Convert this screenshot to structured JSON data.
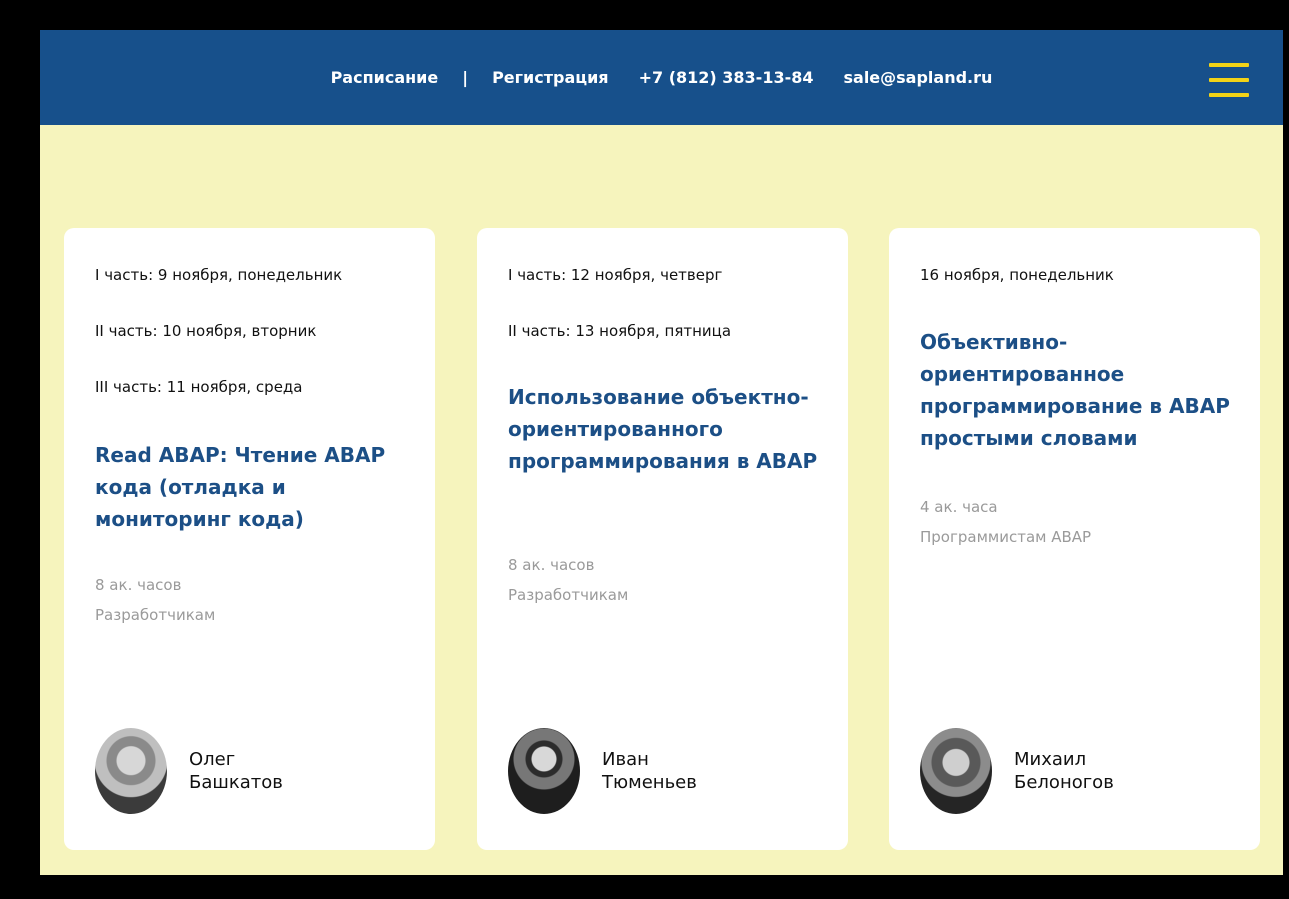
{
  "header": {
    "nav": {
      "schedule": "Расписание",
      "separator": "|",
      "registration": "Регистрация",
      "phone": "+7 (812) 383-13-84",
      "email": "sale@sapland.ru"
    },
    "menu_icon": "hamburger-menu-icon"
  },
  "cards": [
    {
      "dates": [
        "I часть: 9 ноября, понедельник",
        "II часть: 10 ноября, вторник",
        "III часть: 11 ноября, среда"
      ],
      "title": "Read ABAP: Чтение ABAP кода (отладка и мониторинг кода)",
      "hours": "8 ак. часов",
      "audience": "Разработчикам",
      "speaker": {
        "first_name": "Олег",
        "last_name": "Башкатов"
      }
    },
    {
      "dates": [
        "I часть: 12 ноября, четверг",
        "II часть: 13 ноября, пятница"
      ],
      "title": "Использование объектно-ориентированного программирования в ABAP",
      "hours": "8 ак. часов",
      "audience": "Разработчикам",
      "speaker": {
        "first_name": "Иван",
        "last_name": "Тюменьев"
      }
    },
    {
      "dates": [
        "16 ноября, понедельник"
      ],
      "title": "Объективно-ориентированное программирование в ABAP простыми словами",
      "hours": "4 ак. часа",
      "audience": "Программистам ABAP",
      "speaker": {
        "first_name": "Михаил",
        "last_name": "Белоногов"
      }
    }
  ],
  "colors": {
    "header_bg": "#17508b",
    "page_bg": "#f6f4bd",
    "title": "#1c4f86",
    "menu_icon": "#f3d317",
    "meta": "#9a9a9a"
  }
}
